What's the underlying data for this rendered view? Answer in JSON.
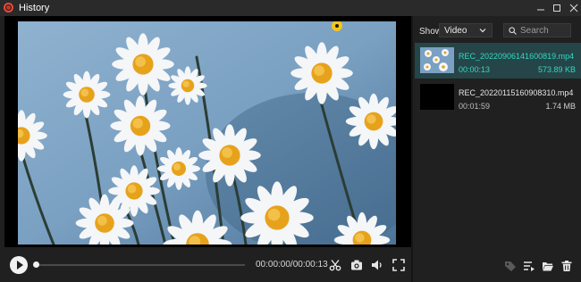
{
  "window": {
    "title": "History"
  },
  "controls": {
    "time": "00:00:00/00:00:13"
  },
  "side": {
    "show_label": "Show",
    "filter_value": "Video",
    "search_placeholder": "Search",
    "items": [
      {
        "name": "REC_20220906141600819.mp4",
        "duration": "00:00:13",
        "size": "573.89 KB",
        "selected": true
      },
      {
        "name": "REC_20220115160908310.mp4",
        "duration": "00:01:59",
        "size": "1.74 MB",
        "selected": false
      }
    ]
  },
  "colors": {
    "accent": "#2fd9c4",
    "selected_bg": "#264548"
  }
}
